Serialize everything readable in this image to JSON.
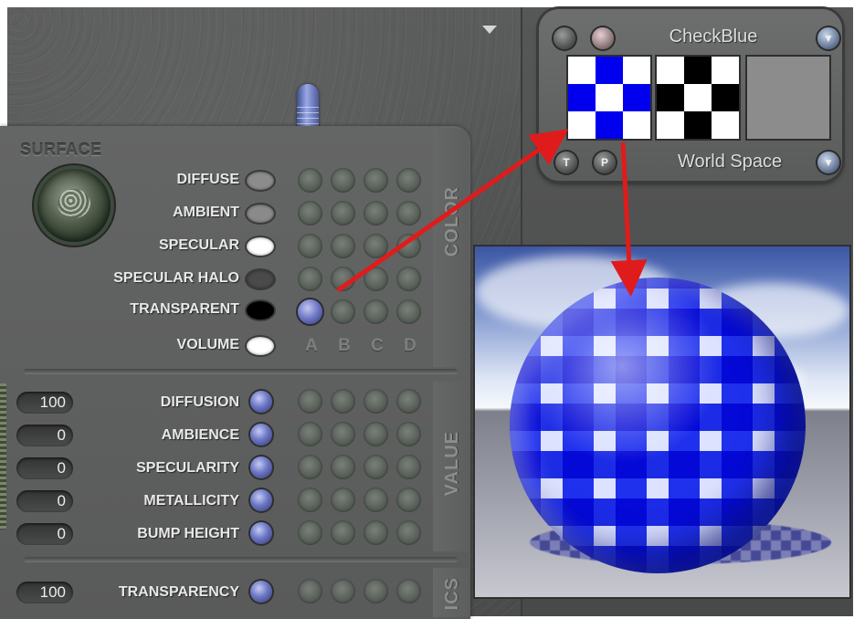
{
  "colors": {
    "panel": "#5a5b5b",
    "knob_blue": "#6c77c4",
    "arrow_red": "#e01b1b",
    "check_blue": "#0000ee"
  },
  "surface": {
    "title": "SURFACE",
    "rows": [
      {
        "label": "DIFFUSE",
        "swatch": "#8c8c8c"
      },
      {
        "label": "AMBIENT",
        "swatch": "#8a8a8a"
      },
      {
        "label": "SPECULAR",
        "swatch": "#ffffff"
      },
      {
        "label": "SPECULAR HALO",
        "swatch": "#4a4a4a"
      },
      {
        "label": "TRANSPARENT",
        "swatch": "#000000"
      },
      {
        "label": "VOLUME",
        "swatch": "#ffffff"
      }
    ],
    "columns": [
      "A",
      "B",
      "C",
      "D"
    ],
    "color_tab": "COLOR",
    "value_tab": "VALUE",
    "ics_tab": "ICS",
    "values": [
      {
        "label": "DIFFUSION",
        "value": "100"
      },
      {
        "label": "AMBIENCE",
        "value": "0"
      },
      {
        "label": "SPECULARITY",
        "value": "0"
      },
      {
        "label": "METALLICITY",
        "value": "0"
      },
      {
        "label": "BUMP HEIGHT",
        "value": "0"
      }
    ],
    "transparency": {
      "label": "TRANSPARENCY",
      "value": "100"
    }
  },
  "texture": {
    "name": "CheckBlue",
    "space": "World Space",
    "btn_t": "T",
    "btn_p": "P",
    "thumbnails": [
      "blue-checker",
      "black-checker",
      "gray"
    ]
  },
  "icons": [
    "dropdown-arrow-icon",
    "chevron-down-icon",
    "sphere-preview-icon"
  ]
}
